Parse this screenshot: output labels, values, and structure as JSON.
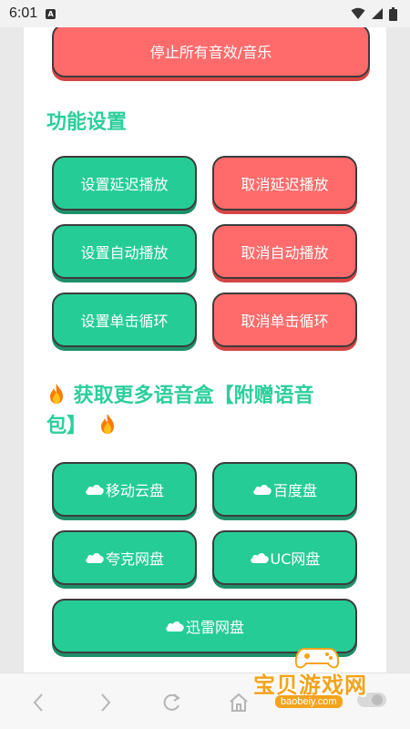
{
  "status": {
    "time": "6:01",
    "notif_letter": "A"
  },
  "top_button": {
    "label": "停止所有音效/音乐"
  },
  "function_section": {
    "title": "功能设置",
    "buttons": [
      {
        "label": "设置延迟播放",
        "color": "green"
      },
      {
        "label": "取消延迟播放",
        "color": "red"
      },
      {
        "label": "设置自动播放",
        "color": "green"
      },
      {
        "label": "取消自动播放",
        "color": "red"
      },
      {
        "label": "设置单击循环",
        "color": "green"
      },
      {
        "label": "取消单击循环",
        "color": "red"
      }
    ]
  },
  "download_section": {
    "title_line1": "获取更多语音盒【附赠语音",
    "title_line2": "包】",
    "buttons": [
      {
        "label": "移动云盘",
        "icon": "cloud-icon"
      },
      {
        "label": "百度盘",
        "icon": "cloud-icon"
      },
      {
        "label": "夸克网盘",
        "icon": "cloud-icon"
      },
      {
        "label": "UC网盘",
        "icon": "cloud-icon"
      },
      {
        "label": "迅雷网盘",
        "icon": "cloud-icon"
      }
    ]
  },
  "watermark": {
    "title": "宝贝游戏网",
    "url": "baobeiy.com"
  },
  "colors": {
    "green": "#25cc96",
    "red": "#ff6b6b",
    "heading": "#2ccf9b"
  }
}
